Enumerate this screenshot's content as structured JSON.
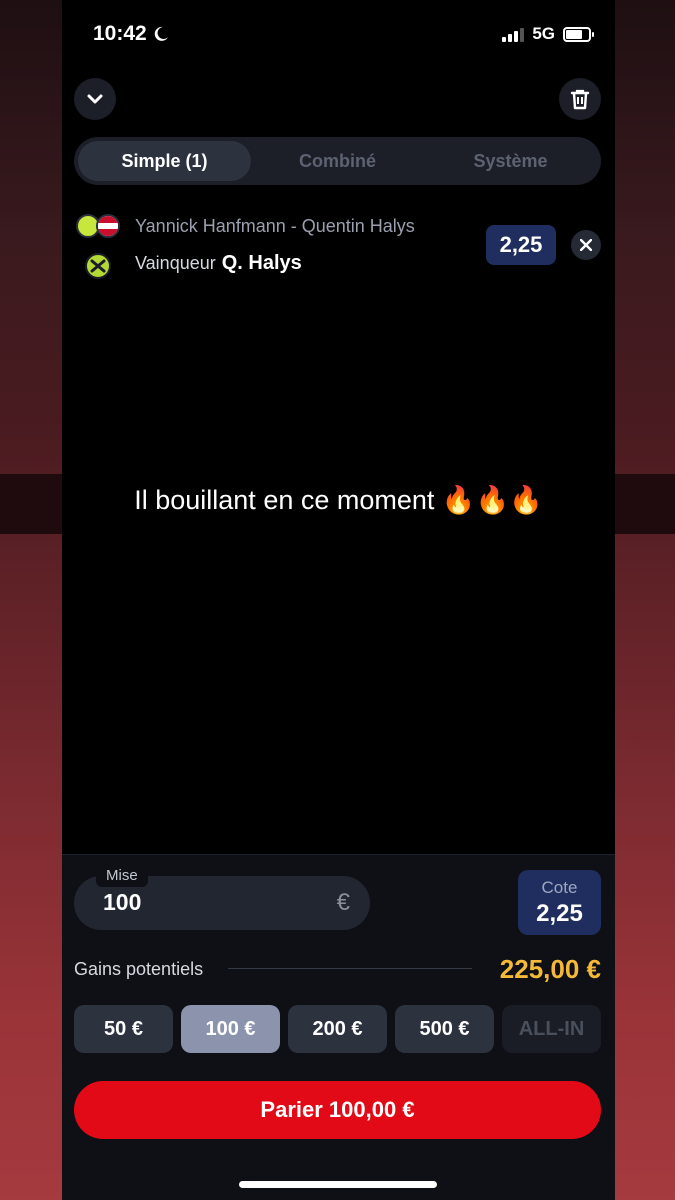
{
  "status_bar": {
    "time": "10:42",
    "network": "5G"
  },
  "tabs": [
    {
      "label": "Simple (1)",
      "active": true
    },
    {
      "label": "Combiné",
      "active": false
    },
    {
      "label": "Système",
      "active": false
    }
  ],
  "bet": {
    "match": "Yannick Hanfmann - Quentin Halys",
    "market": "Vainqueur",
    "selection": "Q. Halys",
    "odds": "2,25"
  },
  "caption": "Il bouillant en ce moment 🔥🔥🔥",
  "stake": {
    "label": "Mise",
    "value": "100",
    "currency": "€"
  },
  "cote": {
    "label": "Cote",
    "value": "2,25"
  },
  "gains": {
    "label": "Gains potentiels",
    "value": "225,00 €"
  },
  "quick_stakes": [
    {
      "label": "50 €",
      "state": "normal"
    },
    {
      "label": "100 €",
      "state": "selected"
    },
    {
      "label": "200 €",
      "state": "normal"
    },
    {
      "label": "500 €",
      "state": "normal"
    },
    {
      "label": "ALL-IN",
      "state": "disabled"
    }
  ],
  "place_bet": {
    "label": "Parier 100,00 €"
  },
  "colors": {
    "accent_red": "#e20a16",
    "gains_gold": "#f4b936",
    "odds_navy": "#1f2e5e"
  }
}
